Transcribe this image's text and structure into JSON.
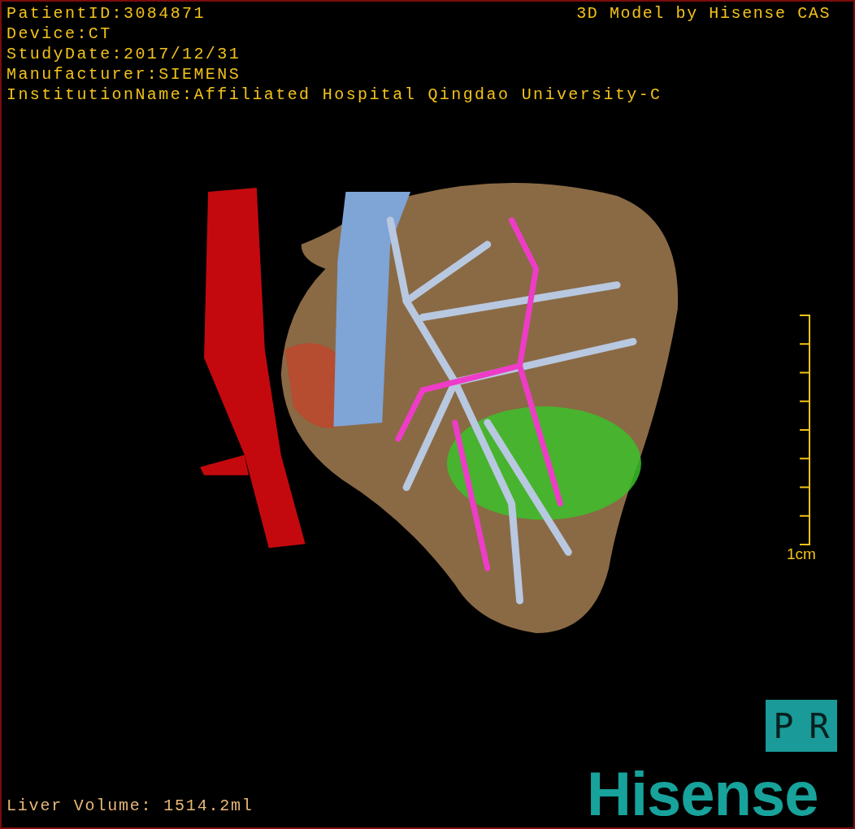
{
  "info_lines": [
    "PatientID:3084871",
    "Device:CT",
    "StudyDate:2017/12/31",
    "Manufacturer:SIEMENS",
    "InstitutionName:Affiliated Hospital Qingdao University-C"
  ],
  "credit": "3D Model by Hisense CAS",
  "scale_bar": {
    "label": "1cm"
  },
  "orientation": [
    "P",
    "R"
  ],
  "volume": "Liver Volume: 1514.2ml",
  "logo": "Hisense"
}
